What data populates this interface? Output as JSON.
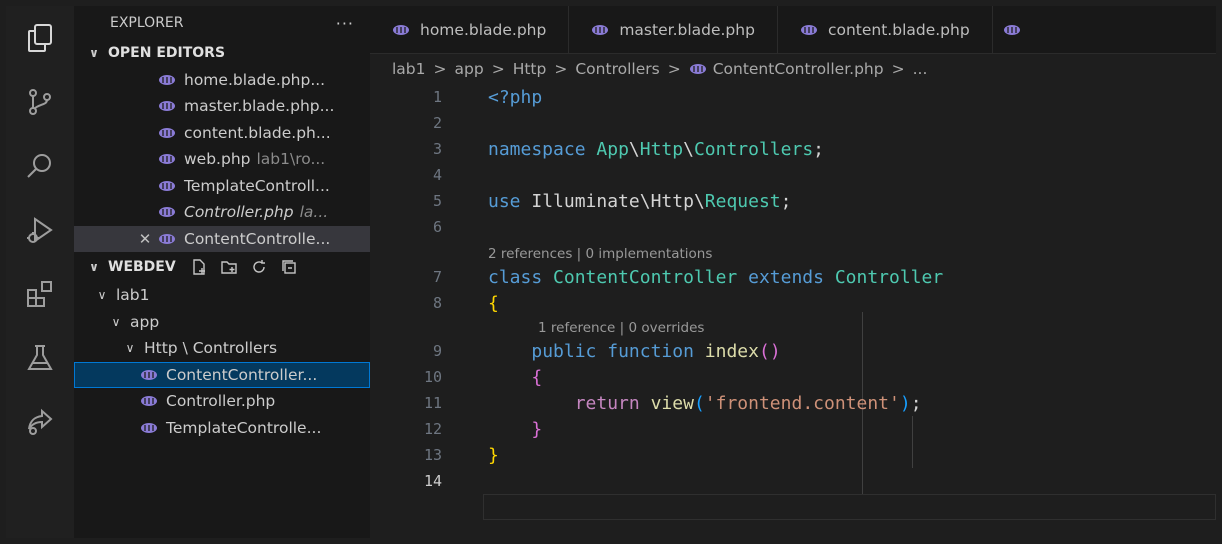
{
  "activity_bar": {
    "icons": [
      "explorer-icon",
      "source-control-icon",
      "search-icon",
      "run-debug-icon",
      "extensions-icon",
      "testing-icon",
      "remote-share-icon"
    ]
  },
  "sidebar": {
    "title": "EXPLORER",
    "more": "···",
    "open_editors": {
      "label": "OPEN EDITORS",
      "items": [
        {
          "name": "home.blade.php...",
          "hint": ""
        },
        {
          "name": "master.blade.php...",
          "hint": ""
        },
        {
          "name": "content.blade.ph...",
          "hint": ""
        },
        {
          "name": "web.php",
          "hint": "lab1\\ro..."
        },
        {
          "name": "TemplateControll...",
          "hint": ""
        },
        {
          "name": "Controller.php",
          "hint": "la..."
        },
        {
          "name": "ContentControlle...",
          "hint": ""
        }
      ]
    },
    "workspace": {
      "label": "WEBDEV",
      "tree": {
        "lab1": "lab1",
        "app": "app",
        "http": "Http \\ Controllers",
        "files": [
          "ContentController...",
          "Controller.php",
          "TemplateControlle..."
        ]
      }
    }
  },
  "tabs": [
    "home.blade.php",
    "master.blade.php",
    "content.blade.php"
  ],
  "breadcrumb": {
    "parts": [
      "lab1",
      "app",
      "Http",
      "Controllers"
    ],
    "file": "ContentController.php",
    "tail": "..."
  },
  "code": {
    "line_numbers": [
      "1",
      "2",
      "3",
      "4",
      "5",
      "6",
      "7",
      "8",
      "9",
      "10",
      "11",
      "12",
      "13",
      "14"
    ],
    "tokens": {
      "php_open": "<?php",
      "namespace_kw": "namespace",
      "ns_app": "App",
      "ns_sep": "\\",
      "ns_http": "Http",
      "ns_controllers": "Controllers",
      "semi": ";",
      "use_kw": "use",
      "use_illuminate": "Illuminate",
      "use_http": "Http",
      "use_request": "Request",
      "class_kw": "class",
      "class_name": "ContentController",
      "extends_kw": "extends",
      "parent_class": "Controller",
      "brace_open": "{",
      "brace_close": "}",
      "public_kw": "public",
      "function_kw": "function",
      "method_name": "index",
      "paren_open": "(",
      "paren_close": ")",
      "return_kw": "return",
      "view_fn": "view",
      "view_arg": "'frontend.content'"
    },
    "codelens_class": "2 references | 0 implementations",
    "codelens_method": "1 reference | 0 overrides"
  },
  "colors": {
    "php_icon": "#8a7bd6",
    "selection": "#04395e",
    "accent": "#0078d4"
  }
}
